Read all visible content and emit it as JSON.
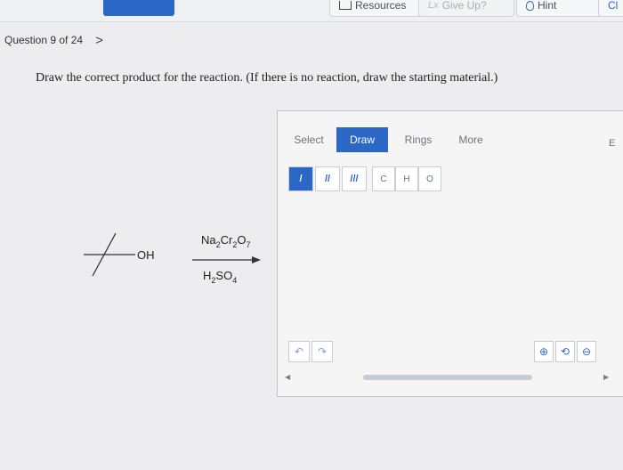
{
  "topbar": {
    "resources_label": "Resources",
    "giveup_icon_text": "Lx",
    "giveup_label": "Give Up?",
    "hint_label": "Hint",
    "next_label": "Cl"
  },
  "question": {
    "label": "Question 9 of 24",
    "chevron": ">"
  },
  "prompt": "Draw the correct product for the reaction. (If there is no reaction, draw the starting material.)",
  "reaction": {
    "substituent": "OH",
    "reagent_top": "Na",
    "reagent_top_sub1": "2",
    "reagent_top_mid": "Cr",
    "reagent_top_sub2": "2",
    "reagent_top_end": "O",
    "reagent_top_sub3": "7",
    "reagent_bottom": "H",
    "reagent_bottom_sub1": "2",
    "reagent_bottom_mid": "SO",
    "reagent_bottom_sub2": "4"
  },
  "editor": {
    "tabs": [
      "Select",
      "Draw",
      "Rings",
      "More"
    ],
    "edge_letter": "E",
    "bonds": [
      "/",
      "//",
      "///"
    ],
    "atoms": [
      "C",
      "H",
      "O"
    ],
    "undo_icons": [
      "↶",
      "↷"
    ],
    "zoom_icons": [
      "⊕",
      "⟲",
      "⊖"
    ],
    "accent_color": "#2b67c6"
  }
}
